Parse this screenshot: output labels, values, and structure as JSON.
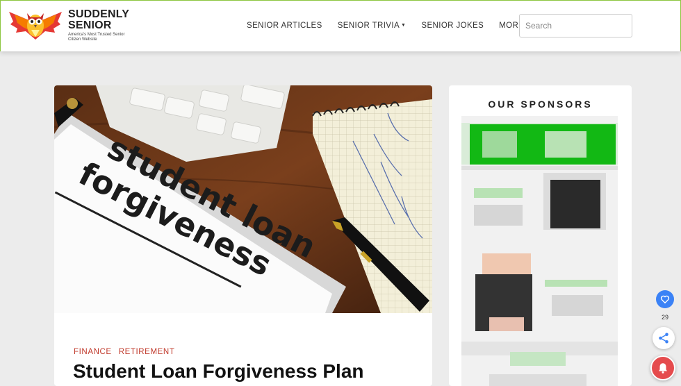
{
  "header": {
    "logo": {
      "name_line1": "SUDDENLY",
      "name_line2": "SENIOR",
      "tagline": "America's Most Trusted Senior Citizen Website"
    },
    "nav": [
      {
        "label": "SENIOR ARTICLES",
        "has_dropdown": false
      },
      {
        "label": "SENIOR TRIVIA",
        "has_dropdown": true
      },
      {
        "label": "SENIOR JOKES",
        "has_dropdown": false
      },
      {
        "label": "MORE...",
        "has_dropdown": true
      }
    ],
    "search": {
      "placeholder": "Search",
      "value": ""
    }
  },
  "article": {
    "hero_text_line1": "student loan",
    "hero_text_line2": "forgiveness",
    "categories": [
      "FINANCE",
      "RETIREMENT"
    ],
    "title": "Student Loan Forgiveness Plan"
  },
  "sidebar": {
    "title": "OUR SPONSORS"
  },
  "share": {
    "count": "29"
  },
  "colors": {
    "accent_green": "#8dc63f",
    "category_red": "#c0392b",
    "share_blue": "#3b82f6",
    "bell_red": "#e54b4d"
  },
  "icons": [
    "owl-logo-icon",
    "caret-down-icon",
    "heart-icon",
    "share-icon",
    "bell-icon"
  ]
}
